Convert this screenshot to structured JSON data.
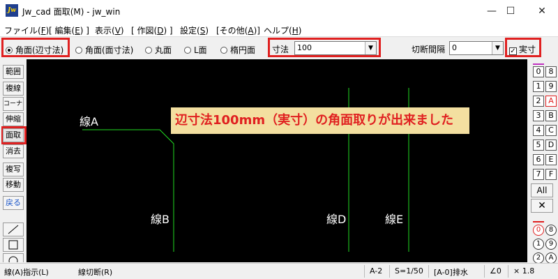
{
  "window": {
    "title": "Jw_cad 面取(M) - jw_win",
    "app_icon": "Jw",
    "min": "—",
    "max": "☐",
    "close": "✕"
  },
  "menu": {
    "items": [
      {
        "pre": "ファイル(",
        "key": "F",
        "post": ")"
      },
      {
        "pre": "[ 編集(",
        "key": "E",
        "post": ") ]"
      },
      {
        "pre": "表示(",
        "key": "V",
        "post": ")"
      },
      {
        "pre": "[ 作図(",
        "key": "D",
        "post": ") ]"
      },
      {
        "pre": "設定(",
        "key": "S",
        "post": ")"
      },
      {
        "pre": "[その他(",
        "key": "A",
        "post": ")]"
      },
      {
        "pre": "ヘルプ(",
        "key": "H",
        "post": ")"
      }
    ]
  },
  "options": {
    "modes": [
      "角面(辺寸法)",
      "角面(面寸法)",
      "丸面",
      "L面",
      "楕円面"
    ],
    "selected_mode": 0,
    "dimension_label": "寸法",
    "dimension_value": "100",
    "cut_interval_label": "切断間隔",
    "cut_interval_value": "0",
    "real_size_label": "実寸",
    "real_size_checked": true,
    "check_glyph": "✓",
    "dropdown_glyph": "▼"
  },
  "left_tools": [
    "範囲",
    "複線",
    "コーナー",
    "伸縮",
    "面取",
    "消去",
    "複写",
    "移動",
    "戻る"
  ],
  "left_tools_active": 4,
  "left_shapes": [
    "line-tool",
    "rect-tool",
    "circle-tool"
  ],
  "canvas": {
    "banner": "辺寸法100mm（実寸）の角面取りが出来ました",
    "labels": {
      "a": "線A",
      "b": "線B",
      "d": "線D",
      "e": "線E"
    },
    "line_color": "#22dd22",
    "accent": "#e02020"
  },
  "layers": {
    "col1": [
      "0",
      "1",
      "2",
      "3",
      "4",
      "5",
      "6",
      "7"
    ],
    "col2": [
      "8",
      "9",
      "A",
      "B",
      "C",
      "D",
      "E",
      "F"
    ],
    "active": "A",
    "all_label": "All",
    "cross_glyph": "✕",
    "groups_col1": [
      "0",
      "1",
      "2"
    ],
    "groups_col2": [
      "8",
      "9",
      "A"
    ]
  },
  "status": {
    "left1": "線(A)指示(L)",
    "left2": "線切断(R)",
    "layer": "A-2",
    "scale": "S=1/50",
    "group": "[A-0]排水",
    "angle": "∠0",
    "factor": "× 1.8"
  }
}
